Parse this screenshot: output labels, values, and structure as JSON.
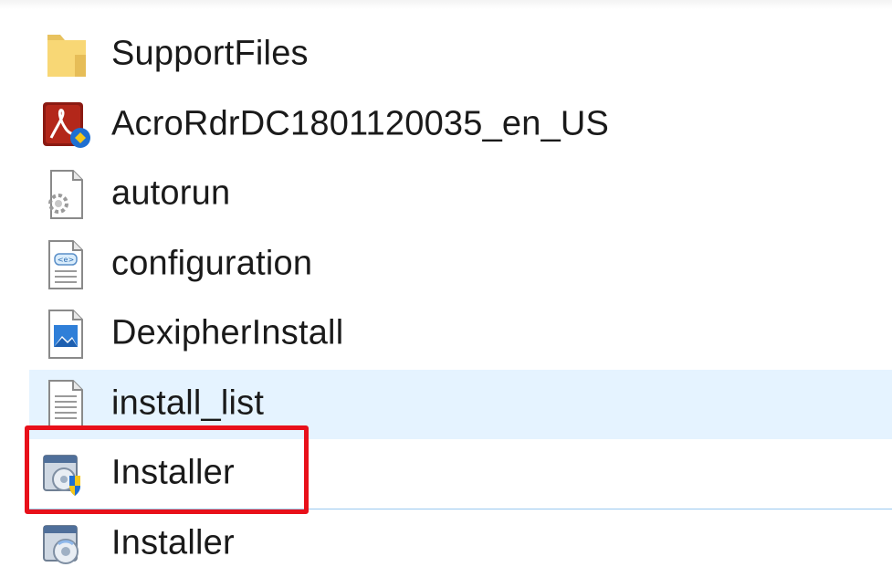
{
  "files": [
    {
      "name": "SupportFiles",
      "icon": "folder-icon",
      "state": "normal"
    },
    {
      "name": "AcroRdrDC1801120035_en_US",
      "icon": "acrobat-installer-icon",
      "state": "normal"
    },
    {
      "name": "autorun",
      "icon": "settings-file-icon",
      "state": "normal"
    },
    {
      "name": "configuration",
      "icon": "xml-file-icon",
      "state": "normal"
    },
    {
      "name": "DexipherInstall",
      "icon": "image-file-icon",
      "state": "normal"
    },
    {
      "name": "install_list",
      "icon": "text-file-icon",
      "state": "hovered"
    },
    {
      "name": "Installer",
      "icon": "installer-shield-icon",
      "state": "selected"
    },
    {
      "name": "Installer",
      "icon": "installer-icon",
      "state": "normal"
    }
  ],
  "highlight_color": "#e8101a",
  "hover_color": "#e5f3ff"
}
